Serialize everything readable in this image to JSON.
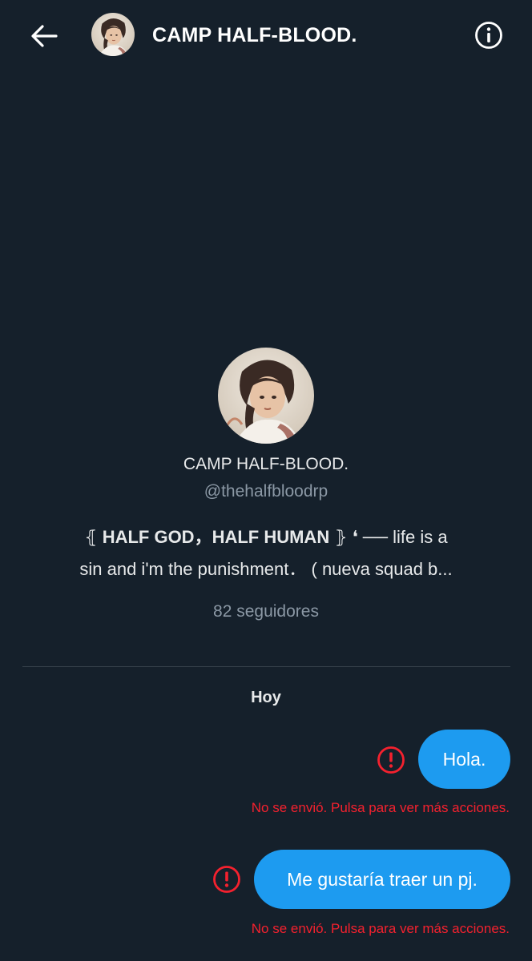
{
  "header": {
    "title": "CAMP HALF-BLOOD.",
    "back_icon": "arrow-left-icon",
    "info_icon": "info-circle-icon"
  },
  "profile": {
    "name": "CAMP HALF-BLOOD.",
    "handle": "@thehalfbloodrp",
    "bio": {
      "bracket_open": "⦃ ",
      "bold_part": "HALF GOD，HALF HUMAN",
      "bracket_close": " ⦄ ",
      "rest_line1": "❛ ── life is a",
      "line2": "sin and i'm the punishment． (   nueva squad b..."
    },
    "followers": "82 seguidores"
  },
  "conversation": {
    "date_separator": "Hoy",
    "messages": [
      {
        "text": "Hola.",
        "status": "No se envió. Pulsa para ver más acciones."
      },
      {
        "text": "Me gustaría traer un pj.",
        "status": "No se envió. Pulsa para ver más acciones."
      }
    ]
  },
  "colors": {
    "background": "#15202b",
    "bubble": "#1d9bf0",
    "error": "#f4212e",
    "muted": "#8b98a5",
    "divider": "#38444d"
  }
}
